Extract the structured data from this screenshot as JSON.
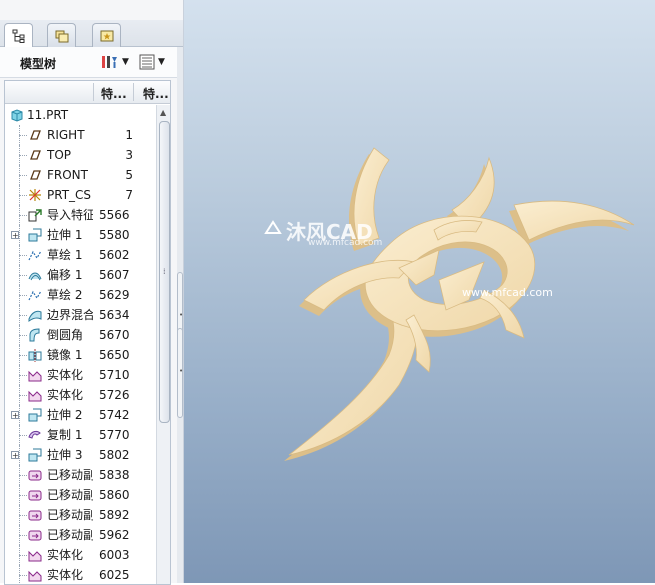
{
  "panel": {
    "tabs": [
      {
        "icon": "model-tree-icon",
        "active": true
      },
      {
        "icon": "folder-browser-icon",
        "active": false
      },
      {
        "icon": "favorites-icon",
        "active": false
      }
    ],
    "title": "模型树",
    "toolbar": {
      "settings_icon": "tree-settings-icon",
      "columns_icon": "tree-columns-icon"
    }
  },
  "tree": {
    "columns": [
      "特...",
      "特..."
    ],
    "root": "11.PRT",
    "rows": [
      {
        "label": "RIGHT",
        "id": "1",
        "icon": "datum-plane-icon",
        "expandable": false
      },
      {
        "label": "TOP",
        "id": "3",
        "icon": "datum-plane-icon",
        "expandable": false
      },
      {
        "label": "FRONT",
        "id": "5",
        "icon": "datum-plane-icon",
        "expandable": false
      },
      {
        "label": "PRT_CS",
        "id": "7",
        "icon": "coordinate-system-icon",
        "expandable": false
      },
      {
        "label": "导入特征",
        "id": "5566",
        "icon": "import-feature-icon",
        "expandable": false
      },
      {
        "label": "拉伸 1",
        "id": "5580",
        "icon": "extrude-icon",
        "expandable": true
      },
      {
        "label": "草绘 1",
        "id": "5602",
        "icon": "sketch-icon",
        "expandable": false
      },
      {
        "label": "偏移 1",
        "id": "5607",
        "icon": "offset-icon",
        "expandable": false
      },
      {
        "label": "草绘 2",
        "id": "5629",
        "icon": "sketch-icon",
        "expandable": false
      },
      {
        "label": "边界混合",
        "id": "5634",
        "icon": "boundary-blend-icon",
        "expandable": false
      },
      {
        "label": "倒圆角",
        "id": "5670",
        "icon": "round-icon",
        "expandable": false
      },
      {
        "label": "镜像 1",
        "id": "5650",
        "icon": "mirror-icon",
        "expandable": false
      },
      {
        "label": "实体化",
        "id": "5710",
        "icon": "solidify-icon",
        "expandable": false
      },
      {
        "label": "实体化",
        "id": "5726",
        "icon": "solidify-icon",
        "expandable": false
      },
      {
        "label": "拉伸 2",
        "id": "5742",
        "icon": "extrude-icon",
        "expandable": true
      },
      {
        "label": "复制 1",
        "id": "5770",
        "icon": "copy-icon",
        "expandable": false
      },
      {
        "label": "拉伸 3",
        "id": "5802",
        "icon": "extrude-icon",
        "expandable": true
      },
      {
        "label": "已移动副本",
        "id": "5838",
        "icon": "moved-copy-icon",
        "expandable": false
      },
      {
        "label": "已移动副本",
        "id": "5860",
        "icon": "moved-copy-icon",
        "expandable": false
      },
      {
        "label": "已移动副本",
        "id": "5892",
        "icon": "moved-copy-icon",
        "expandable": false
      },
      {
        "label": "已移动副本",
        "id": "5962",
        "icon": "moved-copy-icon",
        "expandable": false
      },
      {
        "label": "实体化",
        "id": "6003",
        "icon": "solidify-icon",
        "expandable": false
      },
      {
        "label": "实体化",
        "id": "6025",
        "icon": "solidify-icon",
        "expandable": false
      }
    ]
  },
  "watermark": {
    "brand": "沐风CAD",
    "url_small": "www.mfcad.com",
    "url": "www.mfcad.com"
  },
  "colors": {
    "model_face": "#f4e2bf",
    "model_side": "#e2c690",
    "viewport_top": "#d4e1ee",
    "viewport_bottom": "#7e97b6"
  }
}
